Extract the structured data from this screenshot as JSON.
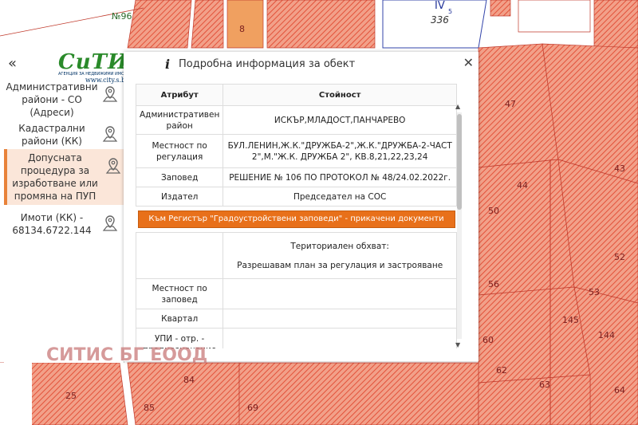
{
  "map": {
    "labels": {
      "n96": "№96",
      "iv": "IV",
      "iv_sup": "5",
      "n336": "336",
      "n8": "8",
      "n25": "25",
      "n85": "85",
      "n84": "84",
      "n47": "47",
      "n44": "44",
      "n43": "43",
      "n50": "50",
      "n52": "52",
      "n56": "56",
      "n53": "53",
      "n60": "60",
      "n145": "145",
      "n144": "144",
      "n62": "62",
      "n63": "63",
      "n69": "69",
      "n64": "64"
    }
  },
  "sidebar": {
    "collapse_glyph": "«",
    "logo": {
      "text": "СиТИС",
      "tagline": "АГЕНЦИЯ ЗА НЕДВИЖИМИ ИМОТИ",
      "url": "www.city.s.bg"
    },
    "items": [
      {
        "label": "Административни\nрайони - СО\n(Адреси)",
        "icon": "map-pin-icon",
        "active": false
      },
      {
        "label": "Кадастрални\nрайони (КК)",
        "icon": "map-pin-icon",
        "active": false
      },
      {
        "label": "Допусната\nпроцедура за\nизработване или\nпромяна на ПУП",
        "icon": "map-pin-icon",
        "active": true
      },
      {
        "label": "Имоти (КК) -\n68134.6722.144",
        "icon": "map-pin-icon",
        "active": false
      }
    ]
  },
  "panel": {
    "info_glyph": "i",
    "title": "Подробна информация за обект",
    "close_glyph": "✕",
    "headers": {
      "attribute": "Атрибут",
      "value": "Стойност"
    },
    "rows": {
      "admin_region": {
        "attr": "Административен район",
        "value": "ИСКЪР,МЛАДОСТ,ПАНЧАРЕВО"
      },
      "locality": {
        "attr": "Местност по регулация",
        "value": "БУЛ.ЛЕНИН,Ж.К.\"ДРУЖБА-2\",Ж.К.\"ДРУЖБА-2-ЧАСТ 2\",М.\"Ж.К. ДРУЖБА 2\", КВ.8,21,22,23,24"
      },
      "order": {
        "attr": "Заповед",
        "value": "РЕШЕНИЕ № 106 ПО ПРОТОКОЛ № 48/24.02.2022г."
      },
      "issuer": {
        "attr": "Издател",
        "value": "Председател на СОС"
      },
      "register_button": "Към Регистър \"Градоустройствени заповеди\" - прикачени документи",
      "scope_title": "Териториален обхват:",
      "scope_text": "Разрешавам план за регулация и застрояване",
      "locality_order": {
        "attr": "Местност по заповед",
        "value": ""
      },
      "block": {
        "attr": "Квартал",
        "value": ""
      },
      "upi": {
        "attr": "УПИ - отр. - предназначение",
        "value": ""
      }
    }
  },
  "watermark": "СИТИС БГ ЕООД"
}
